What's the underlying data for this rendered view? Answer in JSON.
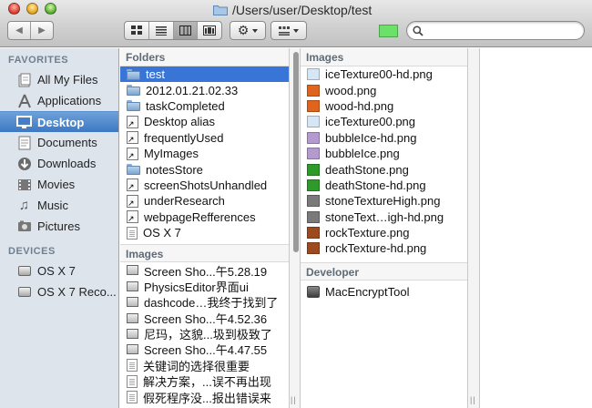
{
  "window": {
    "path": "/Users/user/Desktop/test"
  },
  "toolbar": {
    "tag_color": "#6de06a",
    "search_placeholder": ""
  },
  "sidebar": {
    "favorites_header": "FAVORITES",
    "favorites": [
      {
        "label": "All My Files",
        "icon": "all-files-icon"
      },
      {
        "label": "Applications",
        "icon": "applications-icon"
      },
      {
        "label": "Desktop",
        "icon": "desktop-icon",
        "selected": true
      },
      {
        "label": "Documents",
        "icon": "documents-icon"
      },
      {
        "label": "Downloads",
        "icon": "downloads-icon"
      },
      {
        "label": "Movies",
        "icon": "movies-icon"
      },
      {
        "label": "Music",
        "icon": "music-icon"
      },
      {
        "label": "Pictures",
        "icon": "pictures-icon"
      }
    ],
    "devices_header": "DEVICES",
    "devices": [
      {
        "label": "OS X 7",
        "icon": "disk-icon"
      },
      {
        "label": "OS X 7 Reco...",
        "icon": "disk-icon"
      }
    ]
  },
  "column1": {
    "folders_header": "Folders",
    "folders": [
      {
        "label": "test",
        "type": "folder",
        "selected": true
      },
      {
        "label": "2012.01.21.02.33",
        "type": "folder"
      },
      {
        "label": "taskCompleted",
        "type": "folder"
      },
      {
        "label": "Desktop alias",
        "type": "alias"
      },
      {
        "label": "frequentlyUsed",
        "type": "alias"
      },
      {
        "label": "MyImages",
        "type": "alias"
      },
      {
        "label": "notesStore",
        "type": "folder"
      },
      {
        "label": "screenShotsUnhandled",
        "type": "alias"
      },
      {
        "label": "underResearch",
        "type": "alias"
      },
      {
        "label": "webpageRefferences",
        "type": "alias"
      },
      {
        "label": "OS X 7",
        "type": "doc"
      }
    ],
    "images_header": "Images",
    "images": [
      {
        "label": "Screen Sho...午5.28.19",
        "type": "shot"
      },
      {
        "label": "PhysicsEditor界面ui",
        "type": "shot"
      },
      {
        "label": "dashcode…我终于找到了",
        "type": "shot"
      },
      {
        "label": "Screen Sho...午4.52.36",
        "type": "shot"
      },
      {
        "label": "尼玛，这貌...圾到极致了",
        "type": "shot"
      },
      {
        "label": "Screen Sho...午4.47.55",
        "type": "shot"
      },
      {
        "label": "关键词的选择很重要",
        "type": "doc"
      },
      {
        "label": "解决方案，...误不再出现",
        "type": "doc"
      },
      {
        "label": "假死程序没...报出错误来",
        "type": "doc"
      }
    ]
  },
  "column2": {
    "images_header": "Images",
    "images": [
      {
        "label": "iceTexture00-hd.png",
        "color": "#d6e6f4"
      },
      {
        "label": "wood.png",
        "color": "#e0651c"
      },
      {
        "label": "wood-hd.png",
        "color": "#e0651c"
      },
      {
        "label": "iceTexture00.png",
        "color": "#d6e6f4"
      },
      {
        "label": "bubbleIce-hd.png",
        "color": "#b59ad0"
      },
      {
        "label": "bubbleIce.png",
        "color": "#b59ad0"
      },
      {
        "label": "deathStone.png",
        "color": "#2e9a2a"
      },
      {
        "label": "deathStone-hd.png",
        "color": "#2e9a2a"
      },
      {
        "label": "stoneTextureHigh.png",
        "color": "#7a7a7a"
      },
      {
        "label": "stoneText…igh-hd.png",
        "color": "#7a7a7a"
      },
      {
        "label": "rockTexture.png",
        "color": "#9c4a1e"
      },
      {
        "label": "rockTexture-hd.png",
        "color": "#9c4a1e"
      }
    ],
    "developer_header": "Developer",
    "developer": [
      {
        "label": "MacEncryptTool",
        "type": "app"
      }
    ]
  }
}
